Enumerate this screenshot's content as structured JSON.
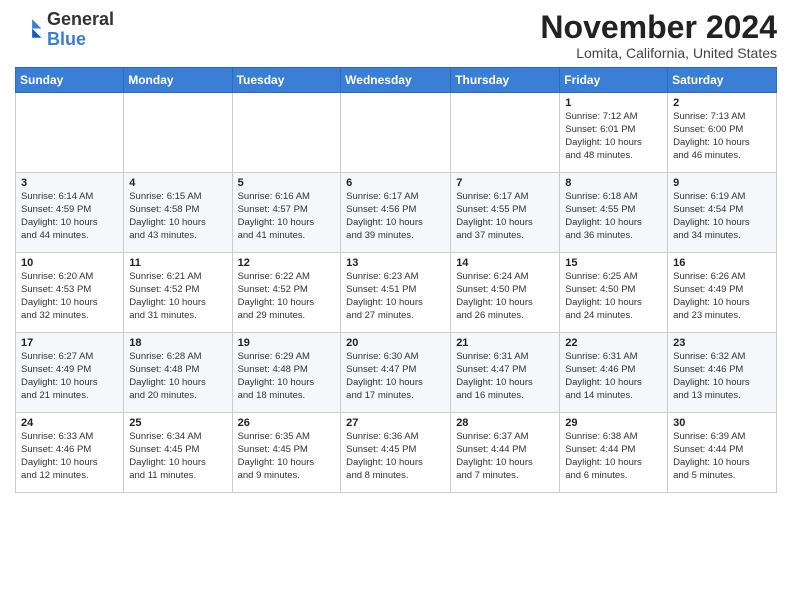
{
  "header": {
    "logo_line1": "General",
    "logo_line2": "Blue",
    "month": "November 2024",
    "location": "Lomita, California, United States"
  },
  "weekdays": [
    "Sunday",
    "Monday",
    "Tuesday",
    "Wednesday",
    "Thursday",
    "Friday",
    "Saturday"
  ],
  "weeks": [
    [
      {
        "day": "",
        "info": ""
      },
      {
        "day": "",
        "info": ""
      },
      {
        "day": "",
        "info": ""
      },
      {
        "day": "",
        "info": ""
      },
      {
        "day": "",
        "info": ""
      },
      {
        "day": "1",
        "info": "Sunrise: 7:12 AM\nSunset: 6:01 PM\nDaylight: 10 hours\nand 48 minutes."
      },
      {
        "day": "2",
        "info": "Sunrise: 7:13 AM\nSunset: 6:00 PM\nDaylight: 10 hours\nand 46 minutes."
      }
    ],
    [
      {
        "day": "3",
        "info": "Sunrise: 6:14 AM\nSunset: 4:59 PM\nDaylight: 10 hours\nand 44 minutes."
      },
      {
        "day": "4",
        "info": "Sunrise: 6:15 AM\nSunset: 4:58 PM\nDaylight: 10 hours\nand 43 minutes."
      },
      {
        "day": "5",
        "info": "Sunrise: 6:16 AM\nSunset: 4:57 PM\nDaylight: 10 hours\nand 41 minutes."
      },
      {
        "day": "6",
        "info": "Sunrise: 6:17 AM\nSunset: 4:56 PM\nDaylight: 10 hours\nand 39 minutes."
      },
      {
        "day": "7",
        "info": "Sunrise: 6:17 AM\nSunset: 4:55 PM\nDaylight: 10 hours\nand 37 minutes."
      },
      {
        "day": "8",
        "info": "Sunrise: 6:18 AM\nSunset: 4:55 PM\nDaylight: 10 hours\nand 36 minutes."
      },
      {
        "day": "9",
        "info": "Sunrise: 6:19 AM\nSunset: 4:54 PM\nDaylight: 10 hours\nand 34 minutes."
      }
    ],
    [
      {
        "day": "10",
        "info": "Sunrise: 6:20 AM\nSunset: 4:53 PM\nDaylight: 10 hours\nand 32 minutes."
      },
      {
        "day": "11",
        "info": "Sunrise: 6:21 AM\nSunset: 4:52 PM\nDaylight: 10 hours\nand 31 minutes."
      },
      {
        "day": "12",
        "info": "Sunrise: 6:22 AM\nSunset: 4:52 PM\nDaylight: 10 hours\nand 29 minutes."
      },
      {
        "day": "13",
        "info": "Sunrise: 6:23 AM\nSunset: 4:51 PM\nDaylight: 10 hours\nand 27 minutes."
      },
      {
        "day": "14",
        "info": "Sunrise: 6:24 AM\nSunset: 4:50 PM\nDaylight: 10 hours\nand 26 minutes."
      },
      {
        "day": "15",
        "info": "Sunrise: 6:25 AM\nSunset: 4:50 PM\nDaylight: 10 hours\nand 24 minutes."
      },
      {
        "day": "16",
        "info": "Sunrise: 6:26 AM\nSunset: 4:49 PM\nDaylight: 10 hours\nand 23 minutes."
      }
    ],
    [
      {
        "day": "17",
        "info": "Sunrise: 6:27 AM\nSunset: 4:49 PM\nDaylight: 10 hours\nand 21 minutes."
      },
      {
        "day": "18",
        "info": "Sunrise: 6:28 AM\nSunset: 4:48 PM\nDaylight: 10 hours\nand 20 minutes."
      },
      {
        "day": "19",
        "info": "Sunrise: 6:29 AM\nSunset: 4:48 PM\nDaylight: 10 hours\nand 18 minutes."
      },
      {
        "day": "20",
        "info": "Sunrise: 6:30 AM\nSunset: 4:47 PM\nDaylight: 10 hours\nand 17 minutes."
      },
      {
        "day": "21",
        "info": "Sunrise: 6:31 AM\nSunset: 4:47 PM\nDaylight: 10 hours\nand 16 minutes."
      },
      {
        "day": "22",
        "info": "Sunrise: 6:31 AM\nSunset: 4:46 PM\nDaylight: 10 hours\nand 14 minutes."
      },
      {
        "day": "23",
        "info": "Sunrise: 6:32 AM\nSunset: 4:46 PM\nDaylight: 10 hours\nand 13 minutes."
      }
    ],
    [
      {
        "day": "24",
        "info": "Sunrise: 6:33 AM\nSunset: 4:46 PM\nDaylight: 10 hours\nand 12 minutes."
      },
      {
        "day": "25",
        "info": "Sunrise: 6:34 AM\nSunset: 4:45 PM\nDaylight: 10 hours\nand 11 minutes."
      },
      {
        "day": "26",
        "info": "Sunrise: 6:35 AM\nSunset: 4:45 PM\nDaylight: 10 hours\nand 9 minutes."
      },
      {
        "day": "27",
        "info": "Sunrise: 6:36 AM\nSunset: 4:45 PM\nDaylight: 10 hours\nand 8 minutes."
      },
      {
        "day": "28",
        "info": "Sunrise: 6:37 AM\nSunset: 4:44 PM\nDaylight: 10 hours\nand 7 minutes."
      },
      {
        "day": "29",
        "info": "Sunrise: 6:38 AM\nSunset: 4:44 PM\nDaylight: 10 hours\nand 6 minutes."
      },
      {
        "day": "30",
        "info": "Sunrise: 6:39 AM\nSunset: 4:44 PM\nDaylight: 10 hours\nand 5 minutes."
      }
    ]
  ]
}
